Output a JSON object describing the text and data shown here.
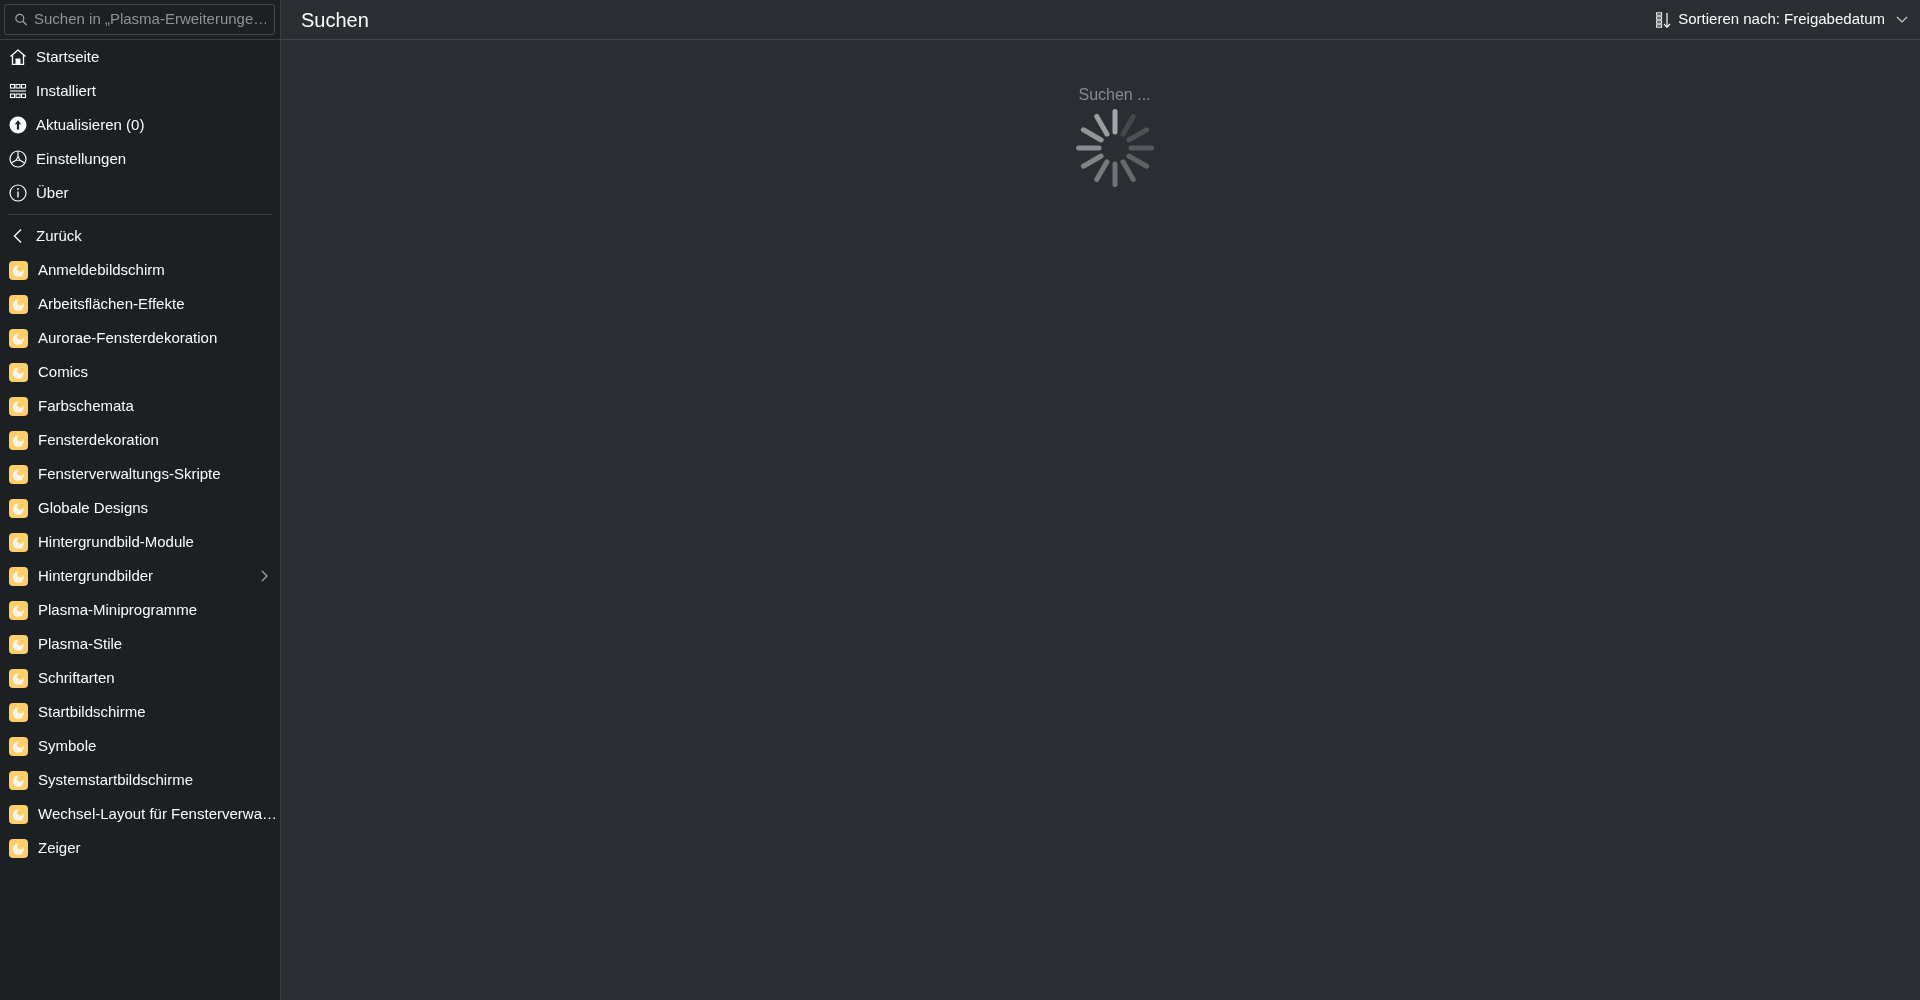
{
  "sidebar": {
    "search": {
      "placeholder": "Suchen in „Plasma-Erweiterunge…"
    },
    "nav_items": [
      {
        "label": "Startseite",
        "selected": false
      },
      {
        "label": "Installiert",
        "selected": false
      },
      {
        "label": "Aktualisieren (0)",
        "selected": false
      },
      {
        "label": "Einstellungen",
        "selected": false
      },
      {
        "label": "Über",
        "selected": false
      }
    ],
    "back": {
      "label": "Zurück"
    },
    "categories": [
      {
        "label": "Anmeldebildschirm",
        "selected": false,
        "expandable": false
      },
      {
        "label": "Arbeitsflächen-Effekte",
        "selected": false,
        "expandable": false
      },
      {
        "label": "Aurorae-Fensterdekoration",
        "selected": false,
        "expandable": false
      },
      {
        "label": "Comics",
        "selected": false,
        "expandable": false
      },
      {
        "label": "Farbschemata",
        "selected": false,
        "expandable": false
      },
      {
        "label": "Fensterdekoration",
        "selected": false,
        "expandable": false
      },
      {
        "label": "Fensterverwaltungs-Skripte",
        "selected": false,
        "expandable": false
      },
      {
        "label": "Globale Designs",
        "selected": false,
        "expandable": false
      },
      {
        "label": "Hintergrundbild-Module",
        "selected": false,
        "expandable": false
      },
      {
        "label": "Hintergrundbilder",
        "selected": false,
        "expandable": true
      },
      {
        "label": "Plasma-Miniprogramme",
        "selected": false,
        "expandable": false
      },
      {
        "label": "Plasma-Stile",
        "selected": false,
        "expandable": false
      },
      {
        "label": "Schriftarten",
        "selected": false,
        "expandable": false
      },
      {
        "label": "Startbildschirme",
        "selected": false,
        "expandable": false
      },
      {
        "label": "Symbole",
        "selected": false,
        "expandable": false
      },
      {
        "label": "Systemstartbildschirme",
        "selected": false,
        "expandable": false
      },
      {
        "label": "Wechsel-Layout für Fensterverwa…",
        "selected": false,
        "expandable": false
      },
      {
        "label": "Zeiger",
        "selected": false,
        "expandable": false
      }
    ]
  },
  "header": {
    "title": "Suchen",
    "sort": {
      "label": "Sortieren nach: Freigabedatum"
    }
  },
  "content": {
    "status": "Suchen ..."
  }
}
